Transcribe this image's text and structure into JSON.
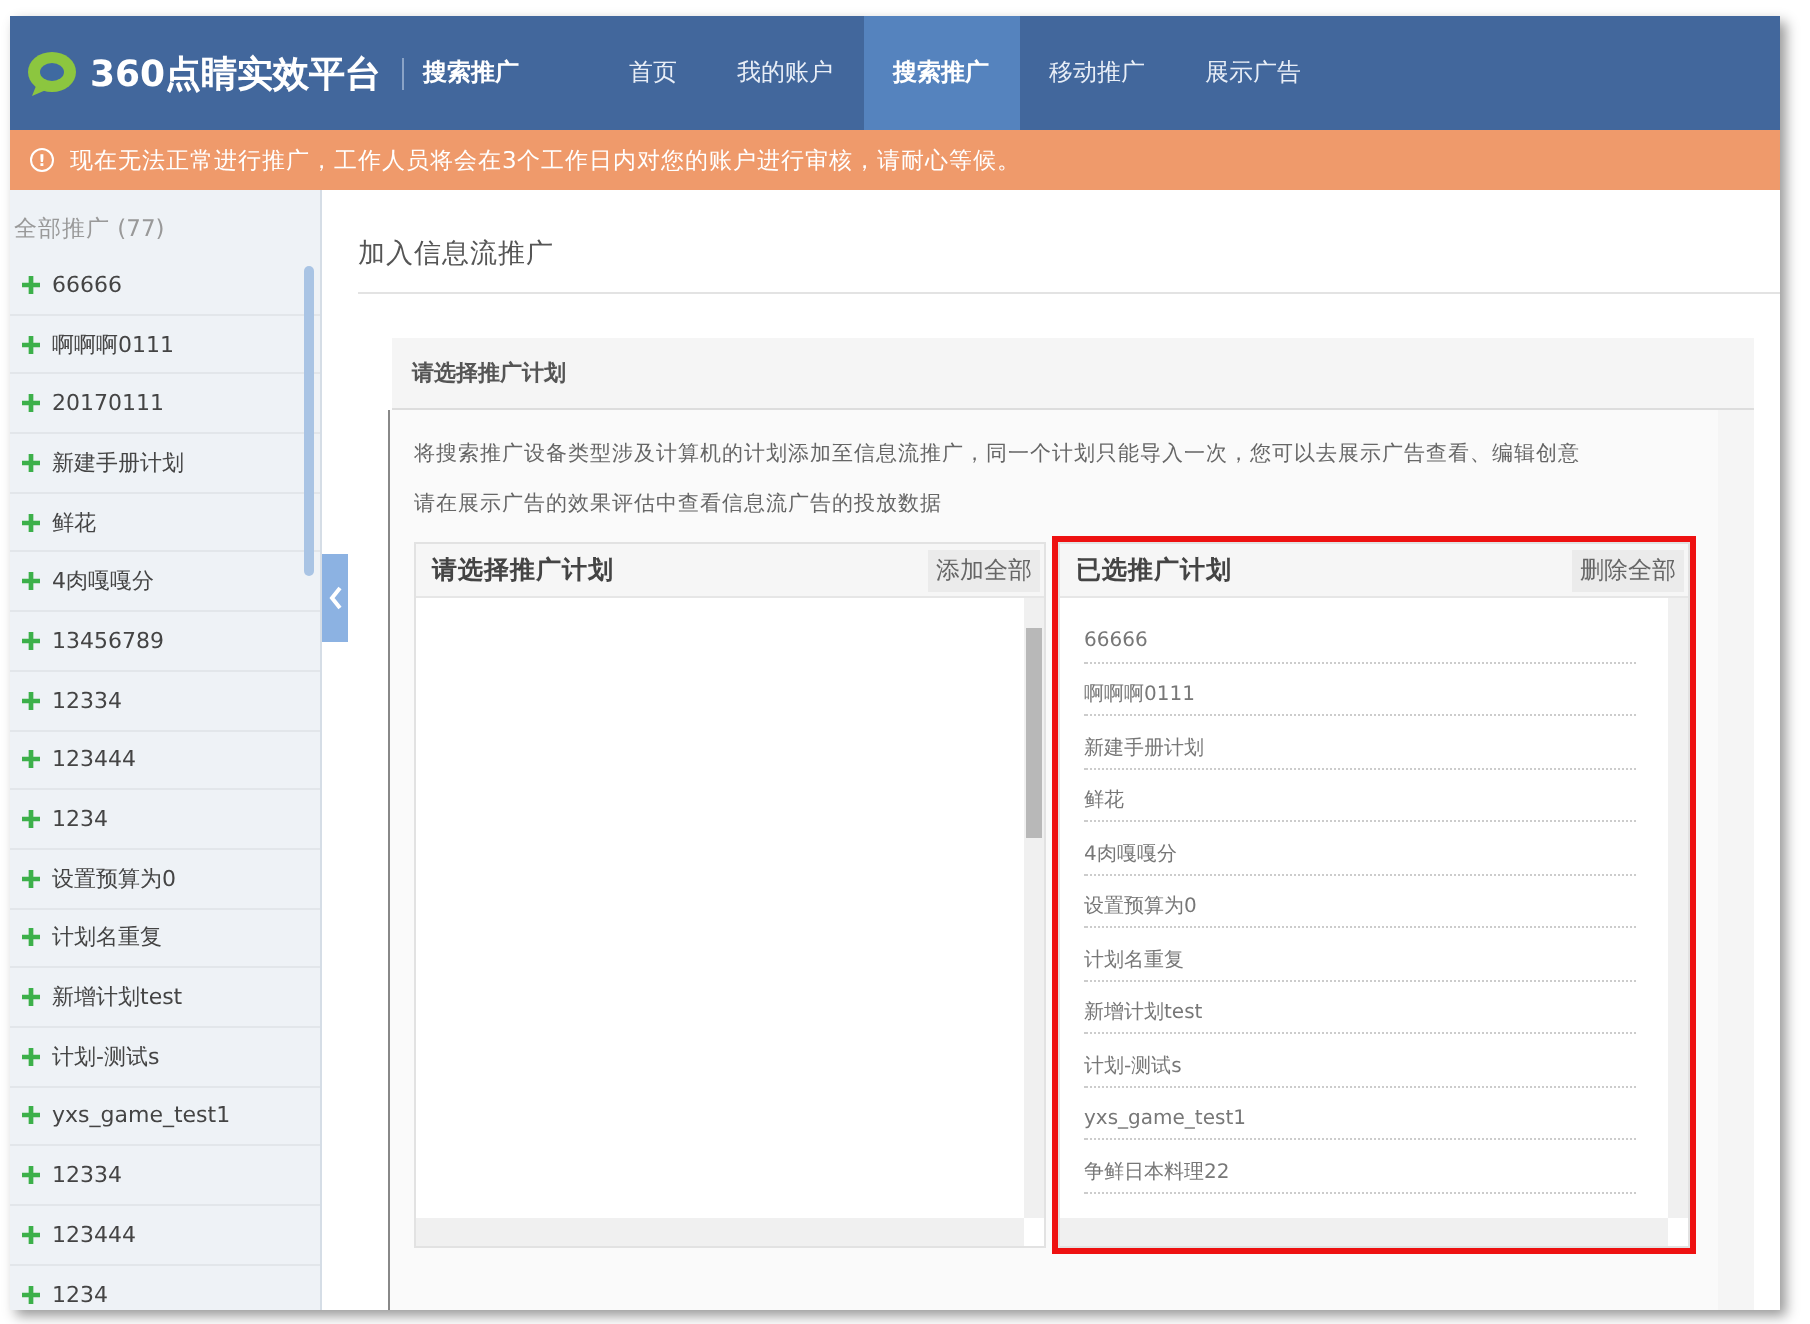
{
  "header": {
    "logo": "360点睛实效平台",
    "product": "搜索推广",
    "nav": [
      {
        "label": "首页",
        "selected": false
      },
      {
        "label": "我的账户",
        "selected": false
      },
      {
        "label": "搜索推广",
        "selected": true
      },
      {
        "label": "移动推广",
        "selected": false
      },
      {
        "label": "展示广告",
        "selected": false
      }
    ]
  },
  "notice": {
    "icon": "!",
    "text": "现在无法正常进行推广，工作人员将会在3个工作日内对您的账户进行审核，请耐心等候。"
  },
  "sidebar": {
    "title": "全部推广 (77)",
    "items": [
      "66666",
      "啊啊啊0111",
      "20170111",
      "新建手册计划",
      "鲜花",
      "4肉嘎嘎分",
      "13456789",
      "12334",
      "123444",
      "1234",
      "设置预算为0",
      "计划名重复",
      "新增计划test",
      "计划-测试s",
      "yxs_game_test1",
      "12334",
      "123444",
      "1234"
    ]
  },
  "page_title": "加入信息流推广",
  "panel": {
    "title": "请选择推广计划",
    "description": [
      "将搜索推广设备类型涉及计算机的计划添加至信息流推广，同一个计划只能导入一次，您可以去展示广告查看、编辑创意",
      "请在展示广告的效果评估中查看信息流广告的投放数据"
    ],
    "available": {
      "title": "请选择推广计划",
      "button": "添加全部"
    },
    "selected": {
      "title": "已选推广计划",
      "button": "删除全部",
      "highlighted": true,
      "items": [
        "66666",
        "啊啊啊0111",
        "新建手册计划",
        "鲜花",
        "4肉嘎嘎分",
        "设置预算为0",
        "计划名重复",
        "新增计划test",
        "计划-测试s",
        "yxs_game_test1",
        "争鲜日本料理22"
      ]
    }
  }
}
